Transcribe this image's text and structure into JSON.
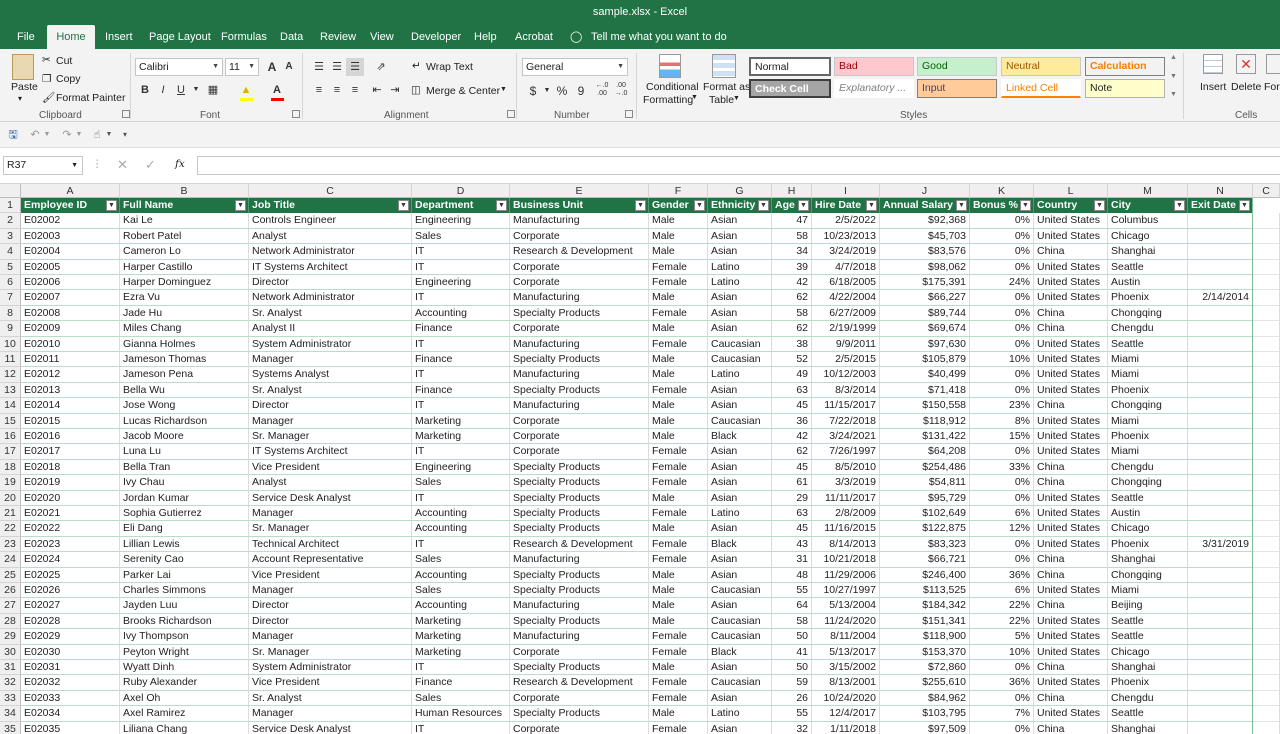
{
  "window": {
    "title": "sample.xlsx  -  Excel"
  },
  "tabs": [
    "File",
    "Home",
    "Insert",
    "Page Layout",
    "Formulas",
    "Data",
    "Review",
    "View",
    "Developer",
    "Help",
    "Acrobat"
  ],
  "tell_me": "Tell me what you want to do",
  "ribbon": {
    "clipboard": {
      "paste": "Paste",
      "cut": "Cut",
      "copy": "Copy",
      "format_painter": "Format Painter",
      "label": "Clipboard"
    },
    "font": {
      "name": "Calibri",
      "size": "11",
      "label": "Font",
      "bold": "B",
      "italic": "I",
      "underline": "U",
      "grow": "A",
      "shrink": "A",
      "color_letter": "A"
    },
    "alignment": {
      "wrap": "Wrap Text",
      "merge": "Merge & Center",
      "label": "Alignment"
    },
    "number": {
      "format": "General",
      "currency": "$",
      "percent": "%",
      "comma": "9",
      "label": "Number",
      "inc_decimal": "←.0\n.00",
      "dec_decimal": ".00\n→.0"
    },
    "styles": {
      "conditional": "Conditional",
      "conditional2": "Formatting",
      "format_as": "Format as",
      "format_as2": "Table",
      "label": "Styles",
      "cells": [
        "Normal",
        "Bad",
        "Good",
        "Neutral",
        "Calculation",
        "Check Cell",
        "Explanatory ...",
        "Input",
        "Linked Cell",
        "Note"
      ]
    },
    "cells": {
      "insert": "Insert",
      "delete": "Delete",
      "format": "Form",
      "label": "Cells"
    }
  },
  "formula_bar": {
    "name_box": "R37",
    "fx": "fx",
    "value": ""
  },
  "columns": [
    "A",
    "B",
    "C",
    "D",
    "E",
    "F",
    "G",
    "H",
    "I",
    "J",
    "K",
    "L",
    "M",
    "N",
    "C"
  ],
  "headers": [
    "Employee ID",
    "Full Name",
    "Job Title",
    "Department",
    "Business Unit",
    "Gender",
    "Ethnicity",
    "Age",
    "Hire Date",
    "Annual Salary",
    "Bonus %",
    "Country",
    "City",
    "Exit Date"
  ],
  "rows": [
    [
      "E02002",
      "Kai Le",
      "Controls Engineer",
      "Engineering",
      "Manufacturing",
      "Male",
      "Asian",
      "47",
      "2/5/2022",
      "$92,368",
      "0%",
      "United States",
      "Columbus",
      ""
    ],
    [
      "E02003",
      "Robert Patel",
      "Analyst",
      "Sales",
      "Corporate",
      "Male",
      "Asian",
      "58",
      "10/23/2013",
      "$45,703",
      "0%",
      "United States",
      "Chicago",
      ""
    ],
    [
      "E02004",
      "Cameron Lo",
      "Network Administrator",
      "IT",
      "Research & Development",
      "Male",
      "Asian",
      "34",
      "3/24/2019",
      "$83,576",
      "0%",
      "China",
      "Shanghai",
      ""
    ],
    [
      "E02005",
      "Harper Castillo",
      "IT Systems Architect",
      "IT",
      "Corporate",
      "Female",
      "Latino",
      "39",
      "4/7/2018",
      "$98,062",
      "0%",
      "United States",
      "Seattle",
      ""
    ],
    [
      "E02006",
      "Harper Dominguez",
      "Director",
      "Engineering",
      "Corporate",
      "Female",
      "Latino",
      "42",
      "6/18/2005",
      "$175,391",
      "24%",
      "United States",
      "Austin",
      ""
    ],
    [
      "E02007",
      "Ezra Vu",
      "Network Administrator",
      "IT",
      "Manufacturing",
      "Male",
      "Asian",
      "62",
      "4/22/2004",
      "$66,227",
      "0%",
      "United States",
      "Phoenix",
      "2/14/2014"
    ],
    [
      "E02008",
      "Jade Hu",
      "Sr. Analyst",
      "Accounting",
      "Specialty Products",
      "Female",
      "Asian",
      "58",
      "6/27/2009",
      "$89,744",
      "0%",
      "China",
      "Chongqing",
      ""
    ],
    [
      "E02009",
      "Miles Chang",
      "Analyst II",
      "Finance",
      "Corporate",
      "Male",
      "Asian",
      "62",
      "2/19/1999",
      "$69,674",
      "0%",
      "China",
      "Chengdu",
      ""
    ],
    [
      "E02010",
      "Gianna Holmes",
      "System Administrator",
      "IT",
      "Manufacturing",
      "Female",
      "Caucasian",
      "38",
      "9/9/2011",
      "$97,630",
      "0%",
      "United States",
      "Seattle",
      ""
    ],
    [
      "E02011",
      "Jameson Thomas",
      "Manager",
      "Finance",
      "Specialty Products",
      "Male",
      "Caucasian",
      "52",
      "2/5/2015",
      "$105,879",
      "10%",
      "United States",
      "Miami",
      ""
    ],
    [
      "E02012",
      "Jameson Pena",
      "Systems Analyst",
      "IT",
      "Manufacturing",
      "Male",
      "Latino",
      "49",
      "10/12/2003",
      "$40,499",
      "0%",
      "United States",
      "Miami",
      ""
    ],
    [
      "E02013",
      "Bella Wu",
      "Sr. Analyst",
      "Finance",
      "Specialty Products",
      "Female",
      "Asian",
      "63",
      "8/3/2014",
      "$71,418",
      "0%",
      "United States",
      "Phoenix",
      ""
    ],
    [
      "E02014",
      "Jose Wong",
      "Director",
      "IT",
      "Manufacturing",
      "Male",
      "Asian",
      "45",
      "11/15/2017",
      "$150,558",
      "23%",
      "China",
      "Chongqing",
      ""
    ],
    [
      "E02015",
      "Lucas Richardson",
      "Manager",
      "Marketing",
      "Corporate",
      "Male",
      "Caucasian",
      "36",
      "7/22/2018",
      "$118,912",
      "8%",
      "United States",
      "Miami",
      ""
    ],
    [
      "E02016",
      "Jacob Moore",
      "Sr. Manager",
      "Marketing",
      "Corporate",
      "Male",
      "Black",
      "42",
      "3/24/2021",
      "$131,422",
      "15%",
      "United States",
      "Phoenix",
      ""
    ],
    [
      "E02017",
      "Luna Lu",
      "IT Systems Architect",
      "IT",
      "Corporate",
      "Female",
      "Asian",
      "62",
      "7/26/1997",
      "$64,208",
      "0%",
      "United States",
      "Miami",
      ""
    ],
    [
      "E02018",
      "Bella Tran",
      "Vice President",
      "Engineering",
      "Specialty Products",
      "Female",
      "Asian",
      "45",
      "8/5/2010",
      "$254,486",
      "33%",
      "China",
      "Chengdu",
      ""
    ],
    [
      "E02019",
      "Ivy Chau",
      "Analyst",
      "Sales",
      "Specialty Products",
      "Female",
      "Asian",
      "61",
      "3/3/2019",
      "$54,811",
      "0%",
      "China",
      "Chongqing",
      ""
    ],
    [
      "E02020",
      "Jordan Kumar",
      "Service Desk Analyst",
      "IT",
      "Specialty Products",
      "Male",
      "Asian",
      "29",
      "11/11/2017",
      "$95,729",
      "0%",
      "United States",
      "Seattle",
      ""
    ],
    [
      "E02021",
      "Sophia Gutierrez",
      "Manager",
      "Accounting",
      "Specialty Products",
      "Female",
      "Latino",
      "63",
      "2/8/2009",
      "$102,649",
      "6%",
      "United States",
      "Austin",
      ""
    ],
    [
      "E02022",
      "Eli Dang",
      "Sr. Manager",
      "Accounting",
      "Specialty Products",
      "Male",
      "Asian",
      "45",
      "11/16/2015",
      "$122,875",
      "12%",
      "United States",
      "Chicago",
      ""
    ],
    [
      "E02023",
      "Lillian Lewis",
      "Technical Architect",
      "IT",
      "Research & Development",
      "Female",
      "Black",
      "43",
      "8/14/2013",
      "$83,323",
      "0%",
      "United States",
      "Phoenix",
      "3/31/2019"
    ],
    [
      "E02024",
      "Serenity Cao",
      "Account Representative",
      "Sales",
      "Manufacturing",
      "Female",
      "Asian",
      "31",
      "10/21/2018",
      "$66,721",
      "0%",
      "China",
      "Shanghai",
      ""
    ],
    [
      "E02025",
      "Parker Lai",
      "Vice President",
      "Accounting",
      "Specialty Products",
      "Male",
      "Asian",
      "48",
      "11/29/2006",
      "$246,400",
      "36%",
      "China",
      "Chongqing",
      ""
    ],
    [
      "E02026",
      "Charles Simmons",
      "Manager",
      "Sales",
      "Specialty Products",
      "Male",
      "Caucasian",
      "55",
      "10/27/1997",
      "$113,525",
      "6%",
      "United States",
      "Miami",
      ""
    ],
    [
      "E02027",
      "Jayden Luu",
      "Director",
      "Accounting",
      "Manufacturing",
      "Male",
      "Asian",
      "64",
      "5/13/2004",
      "$184,342",
      "22%",
      "China",
      "Beijing",
      ""
    ],
    [
      "E02028",
      "Brooks Richardson",
      "Director",
      "Marketing",
      "Specialty Products",
      "Male",
      "Caucasian",
      "58",
      "11/24/2020",
      "$151,341",
      "22%",
      "United States",
      "Seattle",
      ""
    ],
    [
      "E02029",
      "Ivy Thompson",
      "Manager",
      "Marketing",
      "Manufacturing",
      "Female",
      "Caucasian",
      "50",
      "8/11/2004",
      "$118,900",
      "5%",
      "United States",
      "Seattle",
      ""
    ],
    [
      "E02030",
      "Peyton Wright",
      "Sr. Manager",
      "Marketing",
      "Corporate",
      "Female",
      "Black",
      "41",
      "5/13/2017",
      "$153,370",
      "10%",
      "United States",
      "Chicago",
      ""
    ],
    [
      "E02031",
      "Wyatt Dinh",
      "System Administrator",
      "IT",
      "Specialty Products",
      "Male",
      "Asian",
      "50",
      "3/15/2002",
      "$72,860",
      "0%",
      "China",
      "Shanghai",
      ""
    ],
    [
      "E02032",
      "Ruby Alexander",
      "Vice President",
      "Finance",
      "Research & Development",
      "Female",
      "Caucasian",
      "59",
      "8/13/2001",
      "$255,610",
      "36%",
      "United States",
      "Phoenix",
      ""
    ],
    [
      "E02033",
      "Axel Oh",
      "Sr. Analyst",
      "Sales",
      "Corporate",
      "Female",
      "Asian",
      "26",
      "10/24/2020",
      "$84,962",
      "0%",
      "China",
      "Chengdu",
      ""
    ],
    [
      "E02034",
      "Axel Ramirez",
      "Manager",
      "Human Resources",
      "Specialty Products",
      "Male",
      "Latino",
      "55",
      "12/4/2017",
      "$103,795",
      "7%",
      "United States",
      "Seattle",
      ""
    ],
    [
      "E02035",
      "Liliana Chang",
      "Service Desk Analyst",
      "IT",
      "Corporate",
      "Female",
      "Asian",
      "32",
      "1/11/2018",
      "$97,509",
      "0%",
      "China",
      "Shanghai",
      ""
    ]
  ],
  "colors": {
    "excel_green": "#217346",
    "header_fill": "#217346"
  }
}
